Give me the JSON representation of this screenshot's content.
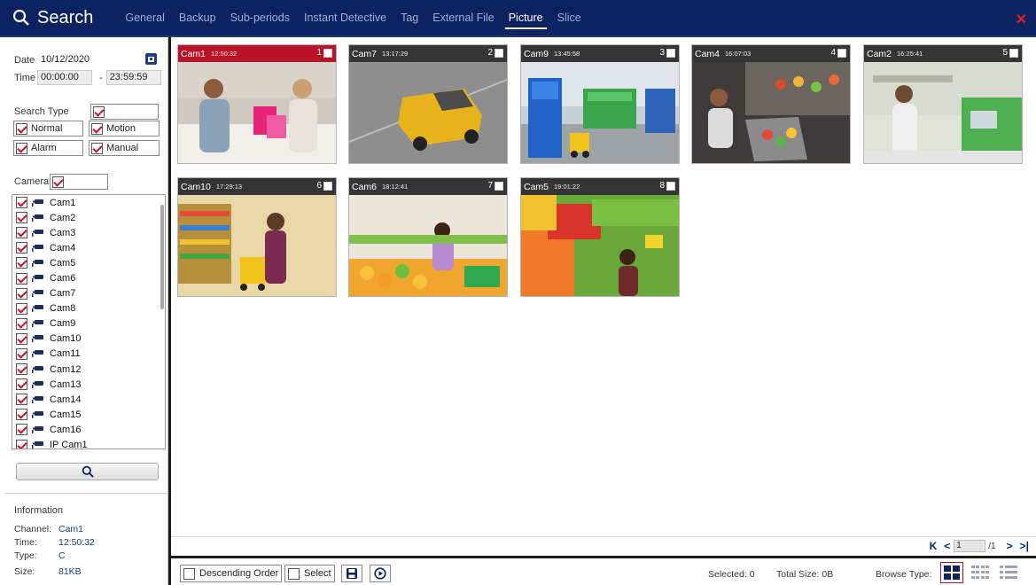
{
  "header": {
    "title": "Search",
    "tabs": [
      "General",
      "Backup",
      "Sub-periods",
      "Instant Detective",
      "Tag",
      "External File",
      "Picture",
      "Slice"
    ],
    "active_tab": "Picture"
  },
  "filters": {
    "date_label": "Date",
    "date_value": "10/12/2020",
    "time_label": "Time",
    "time_start": "00:00:00",
    "time_sep": "-",
    "time_end": "23:59:59",
    "search_type_label": "Search Type",
    "types": [
      "Normal",
      "Motion",
      "Alarm",
      "Manual"
    ],
    "camera_label": "Camera"
  },
  "cameras": [
    "Cam1",
    "Cam2",
    "Cam3",
    "Cam4",
    "Cam5",
    "Cam6",
    "Cam7",
    "Cam8",
    "Cam9",
    "Cam10",
    "Cam11",
    "Cam12",
    "Cam13",
    "Cam14",
    "Cam15",
    "Cam16",
    "IP Cam1"
  ],
  "info": {
    "title": "Information",
    "channel_label": "Channel:",
    "channel": "Cam1",
    "time_label": "Time:",
    "time": "12:50:32",
    "type_label": "Type:",
    "type": "C",
    "size_label": "Size:",
    "size": "81KB"
  },
  "thumbnails": [
    {
      "cam": "Cam1",
      "time": "12:50:32",
      "num": "1",
      "selected": true,
      "scene": "counter"
    },
    {
      "cam": "Cam7",
      "time": "13:17:29",
      "num": "2",
      "selected": false,
      "scene": "van"
    },
    {
      "cam": "Cam9",
      "time": "13:45:58",
      "num": "3",
      "selected": false,
      "scene": "warehouse"
    },
    {
      "cam": "Cam4",
      "time": "16:07:03",
      "num": "4",
      "selected": false,
      "scene": "checkout"
    },
    {
      "cam": "Cam2",
      "time": "16:25:41",
      "num": "5",
      "selected": false,
      "scene": "store"
    },
    {
      "cam": "Cam10",
      "time": "17:29:13",
      "num": "6",
      "selected": false,
      "scene": "aisle"
    },
    {
      "cam": "Cam6",
      "time": "18:12:41",
      "num": "7",
      "selected": false,
      "scene": "produce"
    },
    {
      "cam": "Cam5",
      "time": "19:01:22",
      "num": "8",
      "selected": false,
      "scene": "fruit"
    }
  ],
  "pager": {
    "first": "K",
    "prev": "<",
    "page": "1",
    "total": "/1",
    "next": ">",
    "last": ">|"
  },
  "toolbar": {
    "descending_label": "Descending Order",
    "select_label": "Select",
    "selected_text": "Selected: 0",
    "total_size_text": "Total Size: 0B",
    "browse_type_label": "Browse Type:"
  },
  "colors": {
    "nav_bg": "#0d2260",
    "selected_header": "#b81329",
    "checkmark": "#c8102e"
  }
}
